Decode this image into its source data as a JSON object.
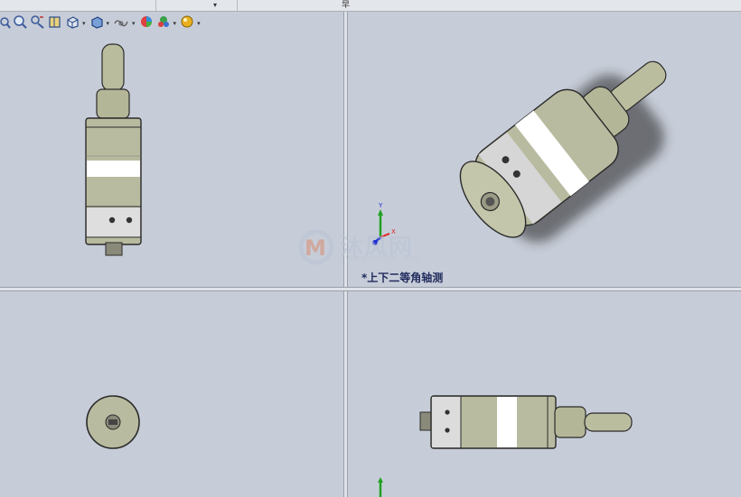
{
  "window": {
    "title_glyph": "早"
  },
  "hud": {
    "tools": [
      {
        "name": "zoom-to-fit-icon"
      },
      {
        "name": "zoom-to-area-icon"
      },
      {
        "name": "previous-view-icon"
      },
      {
        "name": "section-view-icon"
      },
      {
        "name": "view-orientation-icon",
        "dropdown": true
      },
      {
        "name": "display-style-icon",
        "dropdown": true
      },
      {
        "name": "hide-show-items-icon",
        "dropdown": true
      },
      {
        "name": "edit-appearance-icon"
      },
      {
        "name": "apply-scene-icon",
        "dropdown": true
      },
      {
        "name": "view-settings-icon",
        "dropdown": true
      }
    ]
  },
  "viewports": {
    "top_right_label": "*上下二等角轴测"
  },
  "watermark": {
    "text": "沐风网",
    "url": "www.mfcad.com"
  },
  "triad": {
    "x_label": "X",
    "y_label": "Y",
    "z_label": "Z"
  },
  "colors": {
    "viewport_bg": "#c7cdd8",
    "part_body": "#b9bba0",
    "part_band": "#ffffff",
    "part_steel": "#d8d8d8",
    "triad_x": "#e02020",
    "triad_y": "#20a020",
    "triad_z": "#2030d0",
    "label_text": "#1f2a5c"
  }
}
